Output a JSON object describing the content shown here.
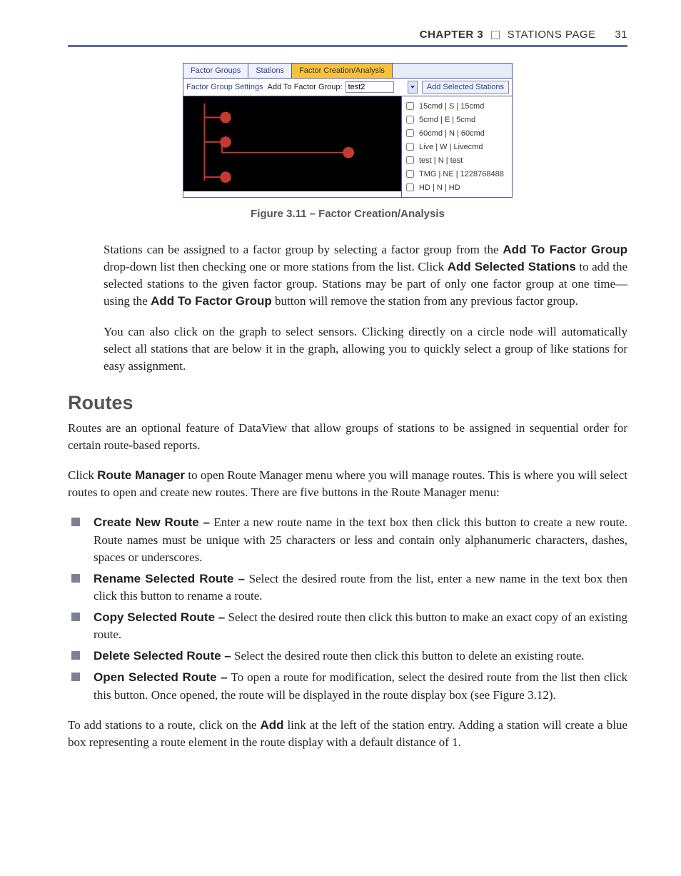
{
  "header": {
    "chapter_label": "CHAPTER 3",
    "section_label": "STATIONS PAGE",
    "page_number": "31"
  },
  "figure": {
    "tabs": [
      "Factor Groups",
      "Stations",
      "Factor Creation/Analysis"
    ],
    "active_tab_index": 2,
    "toolbar_link": "Factor Group Settings",
    "toolbar_label": "Add To Factor Group:",
    "group_value": "test2",
    "add_button": "Add Selected Stations",
    "stations": [
      "15cmd | S | 15cmd",
      "5cmd | E | 5cmd",
      "60cmd | N | 60cmd",
      "Live | W | Livecmd",
      "test | N | test",
      "TMG | NE | 1228768488",
      "HD | N | HD"
    ],
    "caption": "Figure 3.11 – Factor Creation/Analysis"
  },
  "paras": {
    "p1_a": "Stations can be assigned to a factor group by selecting a factor group from the ",
    "p1_b1": "Add To Factor Group",
    "p1_c": " drop-down list then checking one or more stations from the list. Click ",
    "p1_b2": "Add Selected Stations",
    "p1_d": " to add the selected stations to the given factor group. Stations may be part of only one factor group at one time—using the ",
    "p1_b3": "Add To Factor Group",
    "p1_e": " button will remove the station from any previous factor group.",
    "p2": "You can also click on the graph to select sensors. Clicking directly on a circle node will automatically select all stations that are below it in the graph, allowing you to quickly select a group of like stations for easy assignment."
  },
  "routes": {
    "heading": "Routes",
    "intro": "Routes are an optional feature of DataView that allow groups of stations to be assigned in sequential order for certain route-based reports.",
    "menu_a": "Click ",
    "menu_b": "Route Manager",
    "menu_c": " to open Route Manager menu where you will manage routes. This is where you will select routes to open and create new routes. There are five buttons in the Route Manager menu:",
    "items": [
      {
        "title": "Create New Route –",
        "text": " Enter a new route name in the text box then click this button to create a new route. Route names must be unique with 25 characters or less and contain only alphanumeric characters, dashes, spaces or underscores."
      },
      {
        "title": "Rename Selected Route –",
        "text": " Select the desired route from the list, enter a new name in the text box then click this button to rename a route."
      },
      {
        "title": "Copy Selected Route –",
        "text": " Select the desired route then click this button to make an exact copy of an existing route."
      },
      {
        "title": "Delete Selected Route –",
        "text": " Select the desired route then click this button to delete an existing route."
      },
      {
        "title": "Open Selected Route –",
        "text": " To open a route for modification, select the desired route from the list then click this button. Once opened, the route will be displayed in the route display box (see Figure 3.12)."
      }
    ],
    "closing_a": "To add stations to a route, click on the ",
    "closing_b": "Add",
    "closing_c": " link at the left of the station entry. Adding a station will create a blue box representing a route element in the route display with a default distance of 1."
  }
}
